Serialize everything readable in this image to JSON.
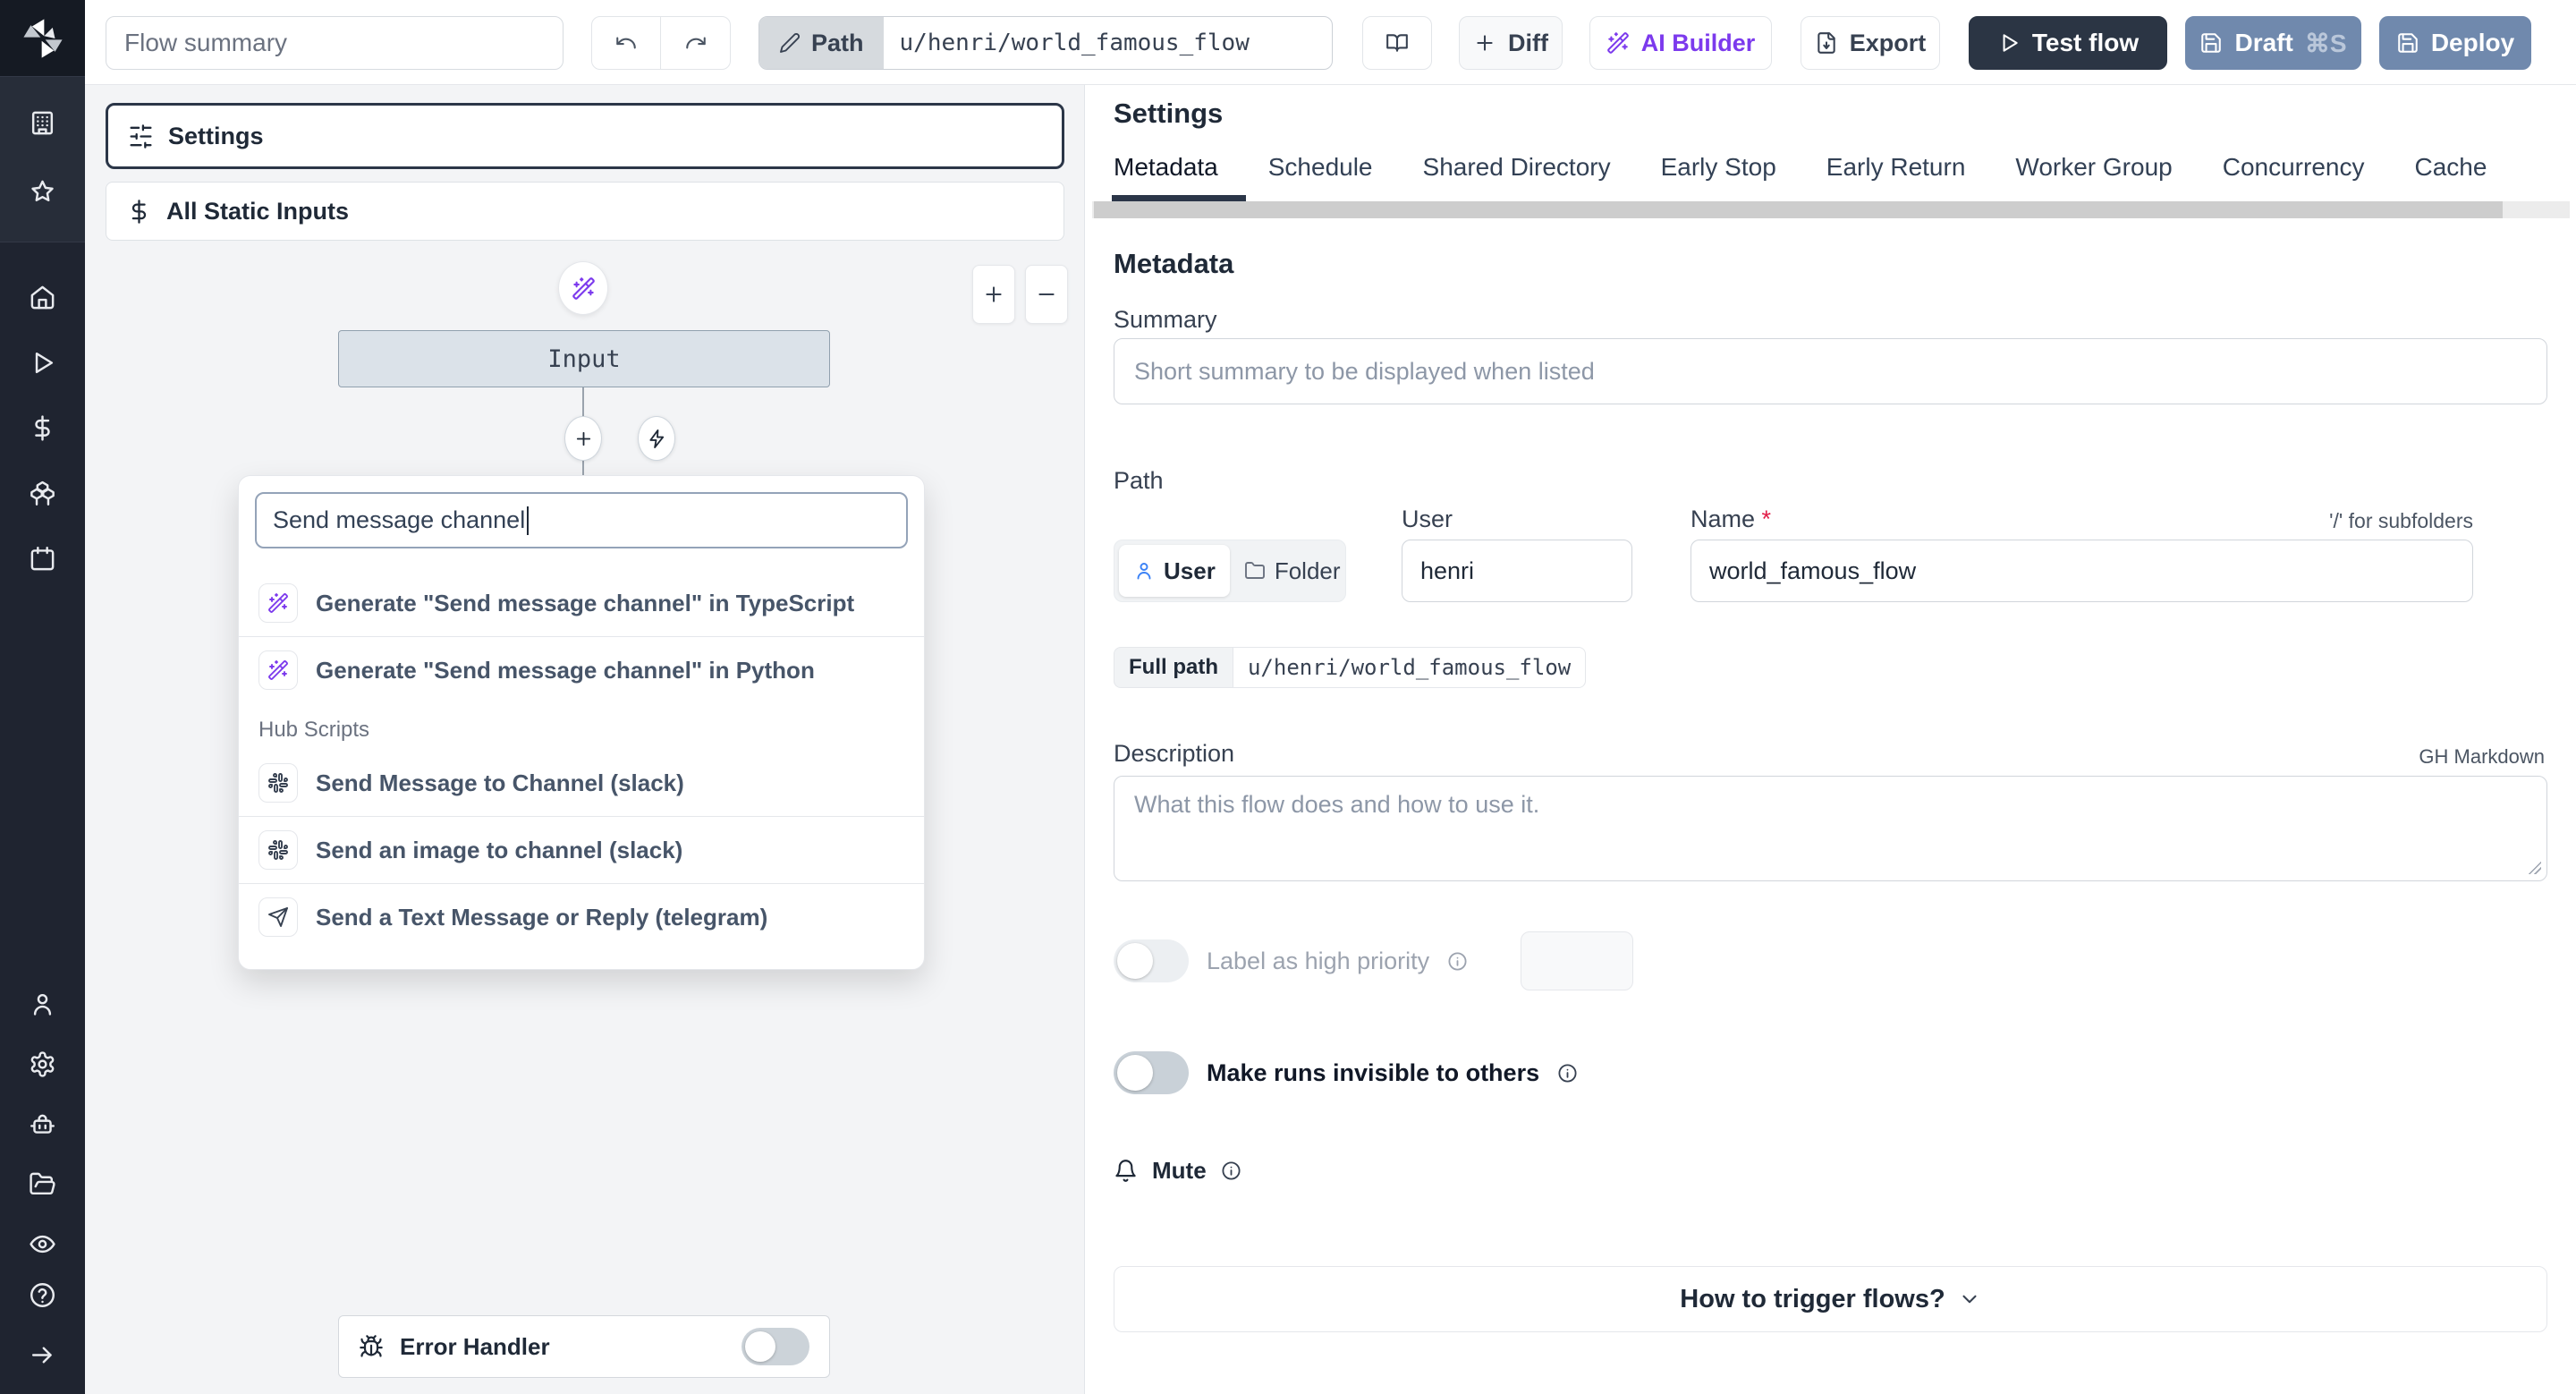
{
  "colors": {
    "accent_purple": "#7c3aed",
    "primary_dark": "#2b3648",
    "slate_button": "#7089ad",
    "canvas_bg": "#f3f4f6"
  },
  "sidebar": {
    "icon_names": [
      "windmill-logo",
      "building-icon",
      "star-icon",
      "home-icon",
      "play-icon",
      "dollar-icon",
      "boxes-icon",
      "calendar-icon",
      "user-icon",
      "gear-icon",
      "robot-icon",
      "folder-icon",
      "eye-icon",
      "help-icon",
      "arrow-right-icon"
    ]
  },
  "topbar": {
    "summary_placeholder": "Flow summary",
    "path_label": "Path",
    "path_value": "u/henri/world_famous_flow",
    "diff_label": "Diff",
    "ai_builder_label": "AI Builder",
    "export_label": "Export",
    "test_flow_label": "Test flow",
    "draft_label": "Draft",
    "draft_shortcut": "⌘S",
    "deploy_label": "Deploy"
  },
  "flow_panel": {
    "settings_card_label": "Settings",
    "static_inputs_label": "All Static Inputs",
    "input_node_label": "Input",
    "zoom_in_label": "+",
    "zoom_out_label": "−",
    "search_value": "Send message channel",
    "results": [
      {
        "icon": "wand-icon",
        "label": "Generate \"Send message channel\" in TypeScript"
      },
      {
        "icon": "wand-icon",
        "label": "Generate \"Send message channel\" in Python"
      }
    ],
    "hub_section_label": "Hub Scripts",
    "hub_results": [
      {
        "icon": "slack-icon",
        "label": "Send Message to Channel (slack)"
      },
      {
        "icon": "slack-icon",
        "label": "Send an image to channel (slack)"
      },
      {
        "icon": "telegram-icon",
        "label": "Send a Text Message or Reply (telegram)"
      }
    ],
    "error_handler_label": "Error Handler"
  },
  "settings_panel": {
    "title": "Settings",
    "tabs": [
      "Metadata",
      "Schedule",
      "Shared Directory",
      "Early Stop",
      "Early Return",
      "Worker Group",
      "Concurrency",
      "Cache"
    ],
    "active_tab": "Metadata",
    "metadata": {
      "heading": "Metadata",
      "summary_label": "Summary",
      "summary_placeholder": "Short summary to be displayed when listed",
      "path_label": "Path",
      "owner_user_label": "User",
      "owner_folder_label": "Folder",
      "user_label": "User",
      "user_value": "henri",
      "name_label": "Name",
      "name_required_mark": "*",
      "subfolder_hint": "'/' for subfolders",
      "name_value": "world_famous_flow",
      "full_path_label": "Full path",
      "full_path_value": "u/henri/world_famous_flow",
      "description_label": "Description",
      "markdown_hint": "GH Markdown",
      "description_placeholder": "What this flow does and how to use it.",
      "high_priority_label": "Label as high priority",
      "invisible_runs_label": "Make runs invisible to others",
      "mute_label": "Mute",
      "trigger_accordion_label": "How to trigger flows?"
    }
  }
}
